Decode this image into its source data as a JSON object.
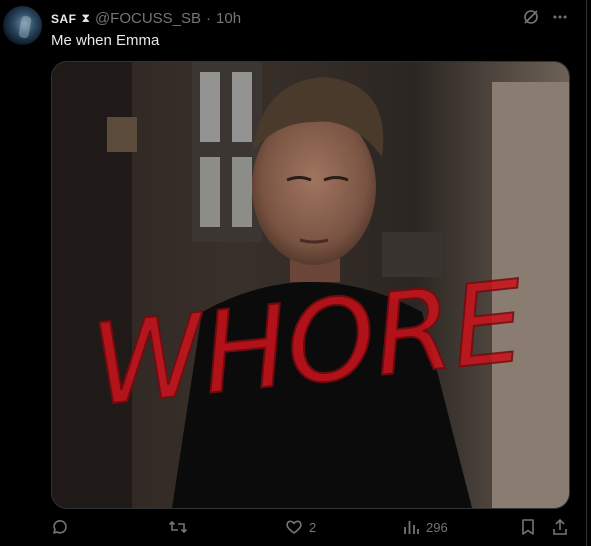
{
  "tweet": {
    "display_name": "SAF",
    "badge_icon": "hourglass-icon",
    "handle": "@FOCUSS_SB",
    "separator": "·",
    "time": "10h",
    "text": "Me when Emma"
  },
  "media": {
    "overlay_text": "WHORE",
    "overlay_color": "#c8141c"
  },
  "actions": {
    "reply_count": "",
    "retweet_count": "",
    "like_count": "2",
    "views_count": "296"
  },
  "colors": {
    "background": "#000000",
    "text": "#e7e9ea",
    "muted": "#71767b",
    "border": "#2f3336"
  }
}
